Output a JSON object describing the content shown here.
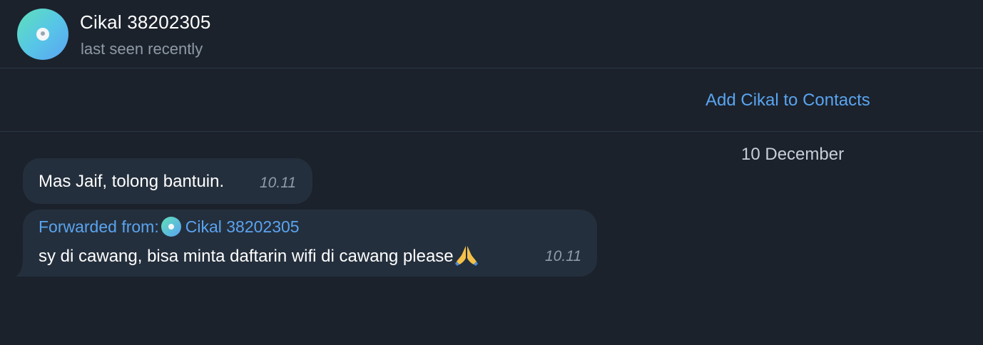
{
  "header": {
    "title": "Cikal 38202305",
    "status": "last seen recently",
    "avatar_icon": "avatar-icon"
  },
  "contact_bar": {
    "add_label": "Add Cikal to Contacts"
  },
  "date_separator": "10 December",
  "messages": [
    {
      "text": "Mas Jaif, tolong bantuin.",
      "time": "10.11"
    },
    {
      "forwarded_label": "Forwarded from:",
      "forwarded_name": "Cikal 38202305",
      "text": "sy di cawang, bisa minta daftarin wifi di cawang please",
      "emoji": "folded-hands-icon",
      "time": "10.11"
    }
  ],
  "colors": {
    "background": "#1b222c",
    "bubble": "#242f3d",
    "accent": "#5aa4ef"
  }
}
